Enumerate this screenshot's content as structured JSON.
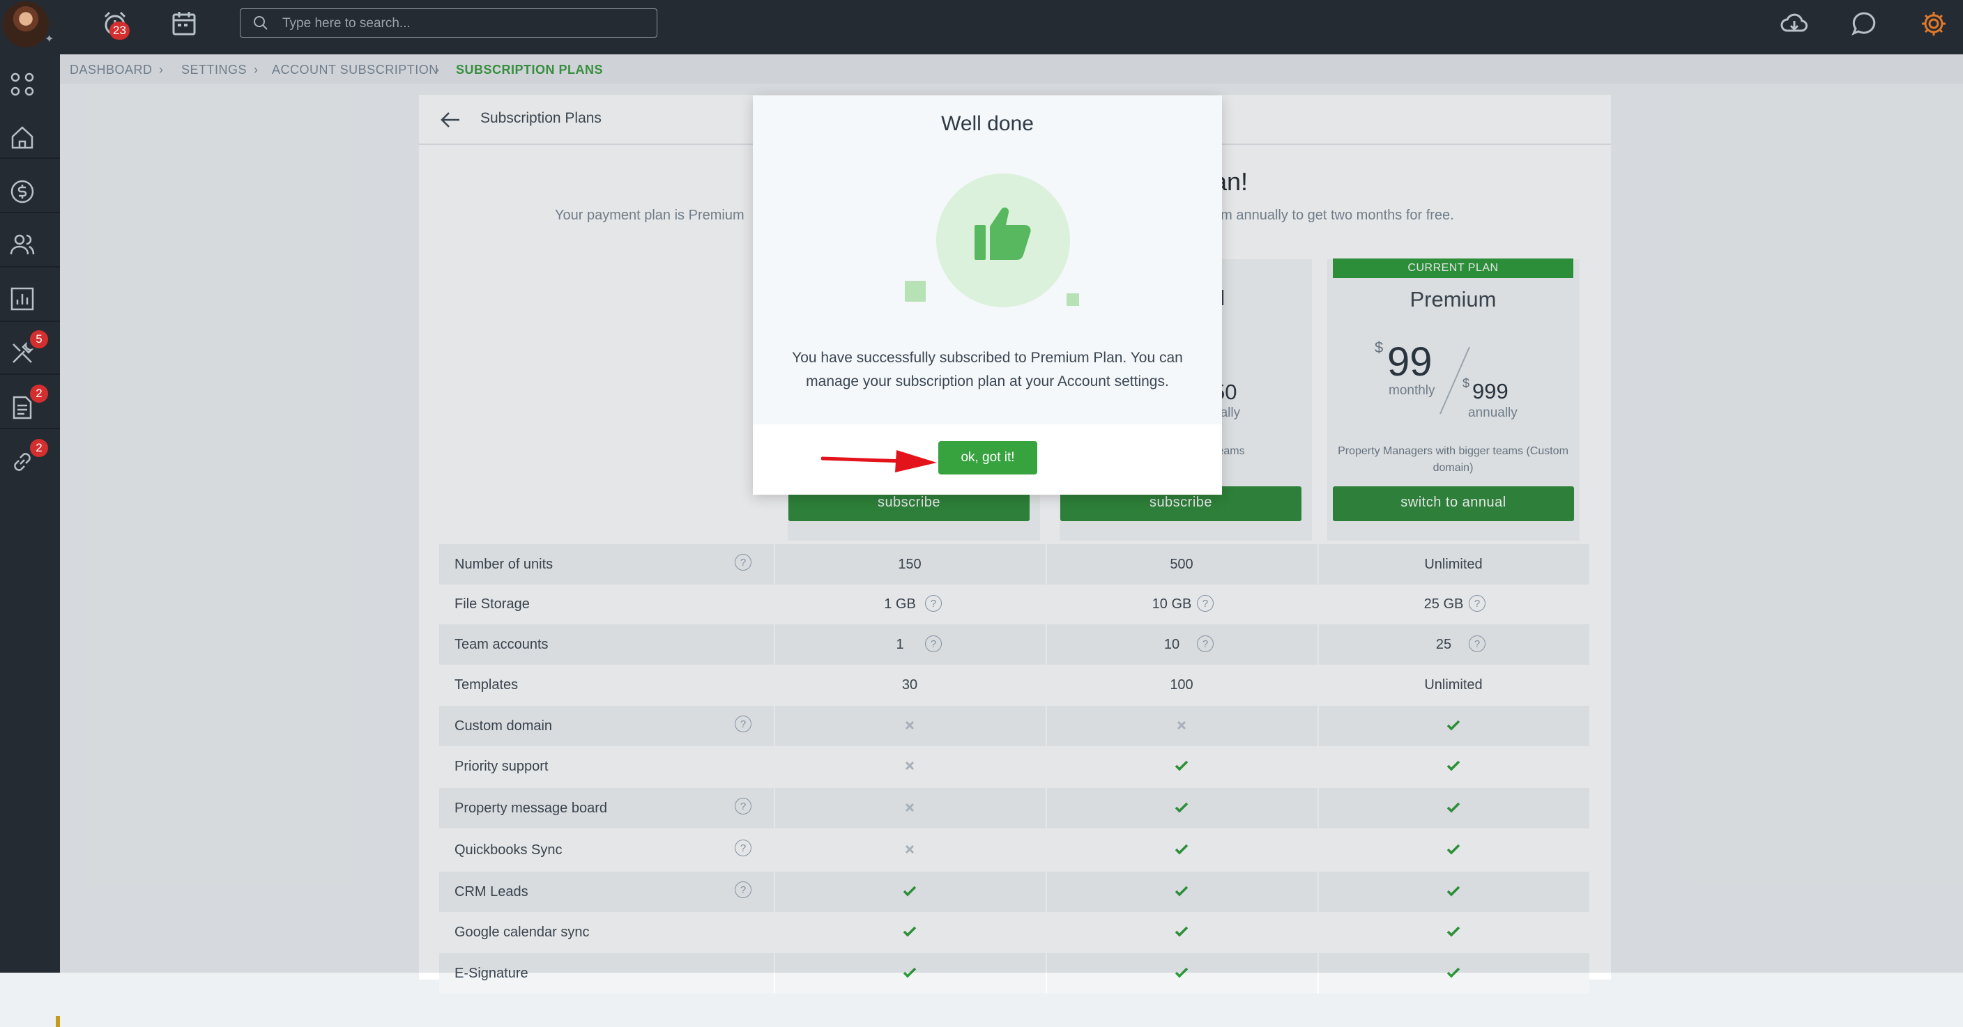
{
  "topbar": {
    "notifications_count": "23",
    "search_placeholder": "Type here to search..."
  },
  "sidebar": {
    "items": [
      {
        "icon": "apps-grid-icon"
      },
      {
        "icon": "home-icon"
      },
      {
        "icon": "dollar-icon"
      },
      {
        "icon": "people-icon"
      },
      {
        "icon": "reports-icon"
      },
      {
        "icon": "tools-icon",
        "badge": "5"
      },
      {
        "icon": "document-icon",
        "badge": "2"
      },
      {
        "icon": "link-icon",
        "badge": "2"
      }
    ]
  },
  "breadcrumb": [
    "DASHBOARD",
    "SETTINGS",
    "ACCOUNT SUBSCRIPTION",
    "SUBSCRIPTION PLANS"
  ],
  "page": {
    "title": "Subscription Plans",
    "headline_visible": "an!",
    "subtitle_left": "Your payment plan is Premium",
    "subtitle_right": "um annually to get two months for free."
  },
  "plans": {
    "col1": {
      "button": "subscribe"
    },
    "col2": {
      "name_fragment": "d",
      "price_fragment": "50",
      "period_fragment": "ually",
      "desc_fragment": "teams",
      "button": "subscribe"
    },
    "col3": {
      "tag": "CURRENT PLAN",
      "name": "Premium",
      "currency": "$",
      "monthly_price": "99",
      "monthly_label": "monthly",
      "annual_price": "999",
      "annual_label": "annually",
      "desc": "Property Managers with bigger teams (Custom domain)",
      "button": "switch to annual"
    }
  },
  "features": [
    {
      "name": "Number of units",
      "help": true,
      "values": [
        "150",
        "500",
        "Unlimited"
      ]
    },
    {
      "name": "File Storage",
      "help": false,
      "values": [
        "1 GB",
        "10 GB",
        "25 GB"
      ],
      "value_help": true
    },
    {
      "name": "Team accounts",
      "help": false,
      "values": [
        "1",
        "10",
        "25"
      ],
      "value_help": true
    },
    {
      "name": "Templates",
      "help": false,
      "values": [
        "30",
        "100",
        "Unlimited"
      ]
    },
    {
      "name": "Custom domain",
      "help": true,
      "values": [
        "x",
        "x",
        "check"
      ]
    },
    {
      "name": "Priority support",
      "help": false,
      "values": [
        "x",
        "check",
        "check"
      ]
    },
    {
      "name": "Property message board",
      "help": true,
      "values": [
        "x",
        "check",
        "check"
      ]
    },
    {
      "name": "Quickbooks Sync",
      "help": true,
      "values": [
        "x",
        "check",
        "check"
      ]
    },
    {
      "name": "CRM Leads",
      "help": true,
      "values": [
        "check",
        "check",
        "check"
      ]
    },
    {
      "name": "Google calendar sync",
      "help": false,
      "values": [
        "check",
        "check",
        "check"
      ]
    },
    {
      "name": "E-Signature",
      "help": false,
      "values": [
        "check",
        "check",
        "check"
      ]
    }
  ],
  "modal": {
    "title": "Well done",
    "message": "You have successfully subscribed to Premium Plan. You can manage your subscription plan at your Account settings.",
    "ok_button": "ok, got it!"
  },
  "help_glyph": "?",
  "colors": {
    "accent_green": "#36a33f",
    "dark_bar": "#252b33",
    "badge_red": "#d32f2f",
    "arrow_red": "#e3131b"
  }
}
